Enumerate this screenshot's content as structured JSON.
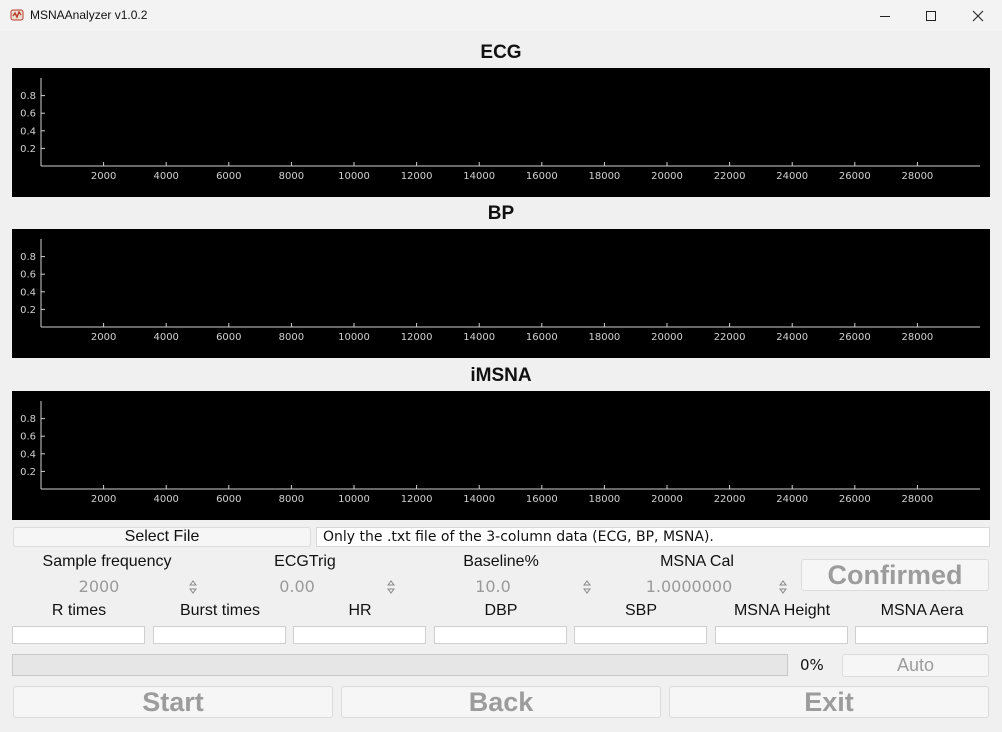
{
  "window": {
    "title": "MSNAAnalyzer v1.0.2"
  },
  "charts": [
    {
      "title": "ECG"
    },
    {
      "title": "BP"
    },
    {
      "title": "iMSNA"
    }
  ],
  "chart_data": [
    {
      "type": "line",
      "title": "ECG",
      "series": [],
      "xlim": [
        0,
        30000
      ],
      "ylim": [
        0,
        1
      ],
      "x_ticks": [
        2000,
        4000,
        6000,
        8000,
        10000,
        12000,
        14000,
        16000,
        18000,
        20000,
        22000,
        24000,
        26000,
        28000
      ],
      "y_ticks": [
        0.2,
        0.4,
        0.6,
        0.8
      ],
      "background": "#000000"
    },
    {
      "type": "line",
      "title": "BP",
      "series": [],
      "xlim": [
        0,
        30000
      ],
      "ylim": [
        0,
        1
      ],
      "x_ticks": [
        2000,
        4000,
        6000,
        8000,
        10000,
        12000,
        14000,
        16000,
        18000,
        20000,
        22000,
        24000,
        26000,
        28000
      ],
      "y_ticks": [
        0.2,
        0.4,
        0.6,
        0.8
      ],
      "background": "#000000"
    },
    {
      "type": "line",
      "title": "iMSNA",
      "series": [],
      "xlim": [
        0,
        30000
      ],
      "ylim": [
        0,
        1
      ],
      "x_ticks": [
        2000,
        4000,
        6000,
        8000,
        10000,
        12000,
        14000,
        16000,
        18000,
        20000,
        22000,
        24000,
        26000,
        28000
      ],
      "y_ticks": [
        0.2,
        0.4,
        0.6,
        0.8
      ],
      "background": "#000000"
    }
  ],
  "file": {
    "select_label": "Select File",
    "info_text": "Only the .txt file of the 3-column data (ECG, BP, MSNA)."
  },
  "params": [
    {
      "label": "Sample frequency",
      "value": "2000"
    },
    {
      "label": "ECGTrig",
      "value": "0.00"
    },
    {
      "label": "Baseline%",
      "value": "10.0"
    },
    {
      "label": "MSNA Cal",
      "value": "1.0000000"
    }
  ],
  "confirmed_label": "Confirmed",
  "outputs": [
    {
      "label": "R times",
      "value": ""
    },
    {
      "label": "Burst times",
      "value": ""
    },
    {
      "label": "HR",
      "value": ""
    },
    {
      "label": "DBP",
      "value": ""
    },
    {
      "label": "SBP",
      "value": ""
    },
    {
      "label": "MSNA Height",
      "value": ""
    },
    {
      "label": "MSNA Aera",
      "value": ""
    }
  ],
  "progress": {
    "value": 0,
    "text": "0%"
  },
  "auto_label": "Auto",
  "actions": {
    "start": "Start",
    "back": "Back",
    "exit": "Exit"
  },
  "colors": {
    "chart_bg": "#000000",
    "axis": "#d0d0d0",
    "disabled_text": "#9c9c9c"
  }
}
